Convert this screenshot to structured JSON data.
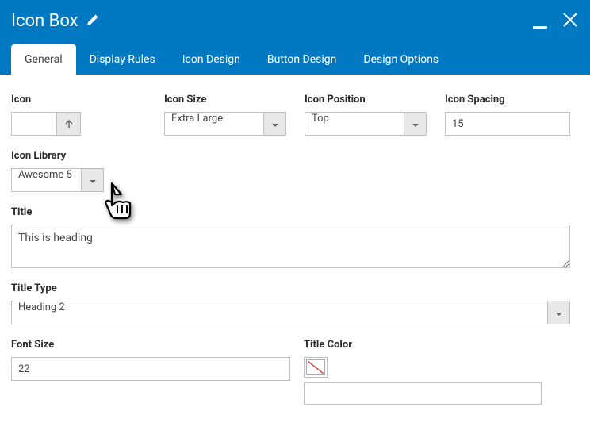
{
  "header": {
    "title": "Icon Box"
  },
  "tabs": [
    {
      "label": "General",
      "active": true
    },
    {
      "label": "Display Rules",
      "active": false
    },
    {
      "label": "Icon Design",
      "active": false
    },
    {
      "label": "Button Design",
      "active": false
    },
    {
      "label": "Design Options",
      "active": false
    }
  ],
  "fields": {
    "icon": {
      "label": "Icon",
      "value": ""
    },
    "icon_size": {
      "label": "Icon Size",
      "value": "Extra Large"
    },
    "icon_position": {
      "label": "Icon Position",
      "value": "Top"
    },
    "icon_spacing": {
      "label": "Icon Spacing",
      "value": "15"
    },
    "icon_library": {
      "label": "Icon Library",
      "value": "Awesome 5"
    },
    "title": {
      "label": "Title",
      "value": "This is heading"
    },
    "title_type": {
      "label": "Title Type",
      "value": "Heading 2"
    },
    "font_size": {
      "label": "Font Size",
      "value": "22"
    },
    "title_color": {
      "label": "Title Color",
      "value": ""
    }
  }
}
